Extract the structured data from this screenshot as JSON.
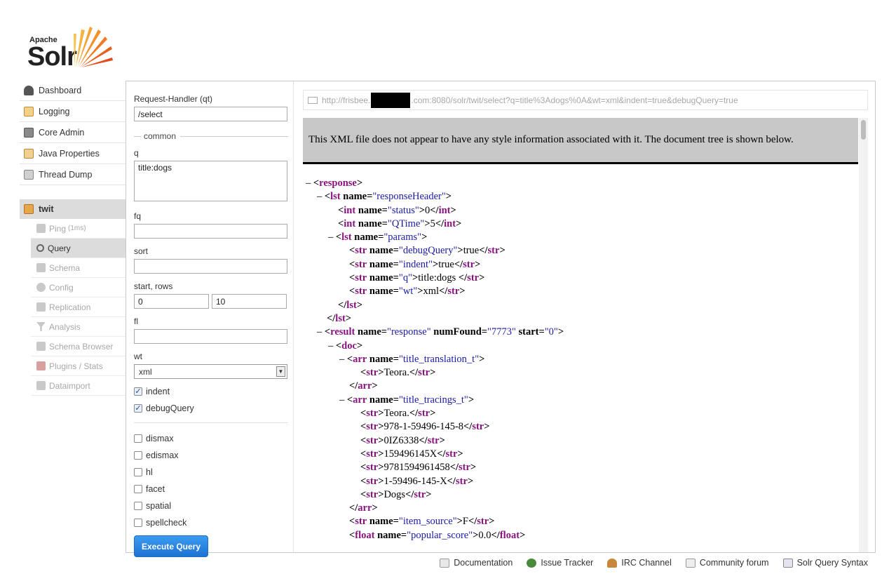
{
  "logo": {
    "top_text": "Apache",
    "main_text": "Solr"
  },
  "nav": [
    {
      "label": "Dashboard",
      "icon": "dashboard-icon",
      "color": "#555555"
    },
    {
      "label": "Logging",
      "icon": "logging-icon",
      "color": "#e0a040"
    },
    {
      "label": "Core Admin",
      "icon": "core-admin-icon",
      "color": "#7a7a7a"
    },
    {
      "label": "Java Properties",
      "icon": "java-properties-icon",
      "color": "#d8a050"
    },
    {
      "label": "Thread Dump",
      "icon": "thread-dump-icon",
      "color": "#999999"
    }
  ],
  "core": {
    "name": "twit",
    "menu": [
      {
        "label": "Ping",
        "suffix": "(1ms)",
        "icon": "ping-icon"
      },
      {
        "label": "Query",
        "suffix": "",
        "icon": "query-icon"
      },
      {
        "label": "Schema",
        "suffix": "",
        "icon": "schema-icon"
      },
      {
        "label": "Config",
        "suffix": "",
        "icon": "config-icon"
      },
      {
        "label": "Replication",
        "suffix": "",
        "icon": "replication-icon"
      },
      {
        "label": "Analysis",
        "suffix": "",
        "icon": "analysis-icon"
      },
      {
        "label": "Schema Browser",
        "suffix": "",
        "icon": "schema-browser-icon"
      },
      {
        "label": "Plugins / Stats",
        "suffix": "",
        "icon": "plugins-icon"
      },
      {
        "label": "Dataimport",
        "suffix": "",
        "icon": "dataimport-icon"
      }
    ]
  },
  "form": {
    "qt_label": "Request-Handler (qt)",
    "qt_value": "/select",
    "common_legend": "common",
    "q_label": "q",
    "q_value": "title:dogs",
    "fq_label": "fq",
    "fq_value": "",
    "sort_label": "sort",
    "sort_value": "",
    "start_rows_label": "start, rows",
    "start_value": "0",
    "rows_value": "10",
    "fl_label": "fl",
    "fl_value": "",
    "wt_label": "wt",
    "wt_value": "xml",
    "indent_label": "indent",
    "debug_label": "debugQuery",
    "options": [
      "dismax",
      "edismax",
      "hl",
      "facet",
      "spatial",
      "spellcheck"
    ],
    "execute_label": "Execute Query"
  },
  "result": {
    "url_prefix": "http://frisbee.",
    "url_suffix": ".com:8080/solr/twit/select?q=title%3Adogs%0A&wt=xml&indent=true&debugQuery=true",
    "xml_notice": "This XML file does not appear to have any style information associated with it. The document tree is shown below.",
    "lines": [
      "<response>",
      "<lst name=\"responseHeader\">",
      "<int name=\"status\">0</int>",
      "<int name=\"QTime\">5</int>",
      "<lst name=\"params\">",
      "<str name=\"debugQuery\">true</str>",
      "<str name=\"indent\">true</str>",
      "<str name=\"q\">title:dogs </str>",
      "<str name=\"wt\">xml</str>",
      "</lst>",
      "</lst>",
      "<result name=\"response\" numFound=\"7773\" start=\"0\">",
      "<doc>",
      "<arr name=\"title_translation_t\">",
      "<str>Teora.</str>",
      "</arr>",
      "<arr name=\"title_tracings_t\">",
      "<str>Teora.</str>",
      "<str>978-1-59496-145-8</str>",
      "<str>0IZ6338</str>",
      "<str>159496145X</str>",
      "<str>9781594961458</str>",
      "<str>1-59496-145-X</str>",
      "<str>Dogs</str>",
      "</arr>",
      "<str name=\"item_source\">F</str>",
      "<float name=\"popular_score\">0.0</float>"
    ]
  },
  "footer": [
    {
      "label": "Documentation",
      "icon": "documentation-icon"
    },
    {
      "label": "Issue Tracker",
      "icon": "bug-icon"
    },
    {
      "label": "IRC Channel",
      "icon": "irc-icon"
    },
    {
      "label": "Community forum",
      "icon": "mail-icon"
    },
    {
      "label": "Solr Query Syntax",
      "icon": "query-syntax-icon"
    }
  ]
}
